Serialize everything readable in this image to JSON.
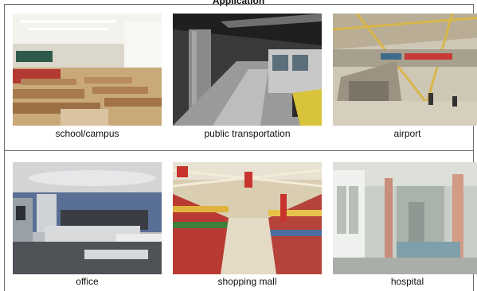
{
  "title": "Application",
  "items": [
    {
      "caption": "school/campus",
      "icon": "classroom-photo"
    },
    {
      "caption": "public transportation",
      "icon": "subway-platform-photo"
    },
    {
      "caption": "airport",
      "icon": "airport-terminal-photo"
    },
    {
      "caption": "office",
      "icon": "office-interior-photo"
    },
    {
      "caption": "shopping mall",
      "icon": "supermarket-aisle-photo"
    },
    {
      "caption": "hospital",
      "icon": "hospital-corridor-photo"
    }
  ]
}
